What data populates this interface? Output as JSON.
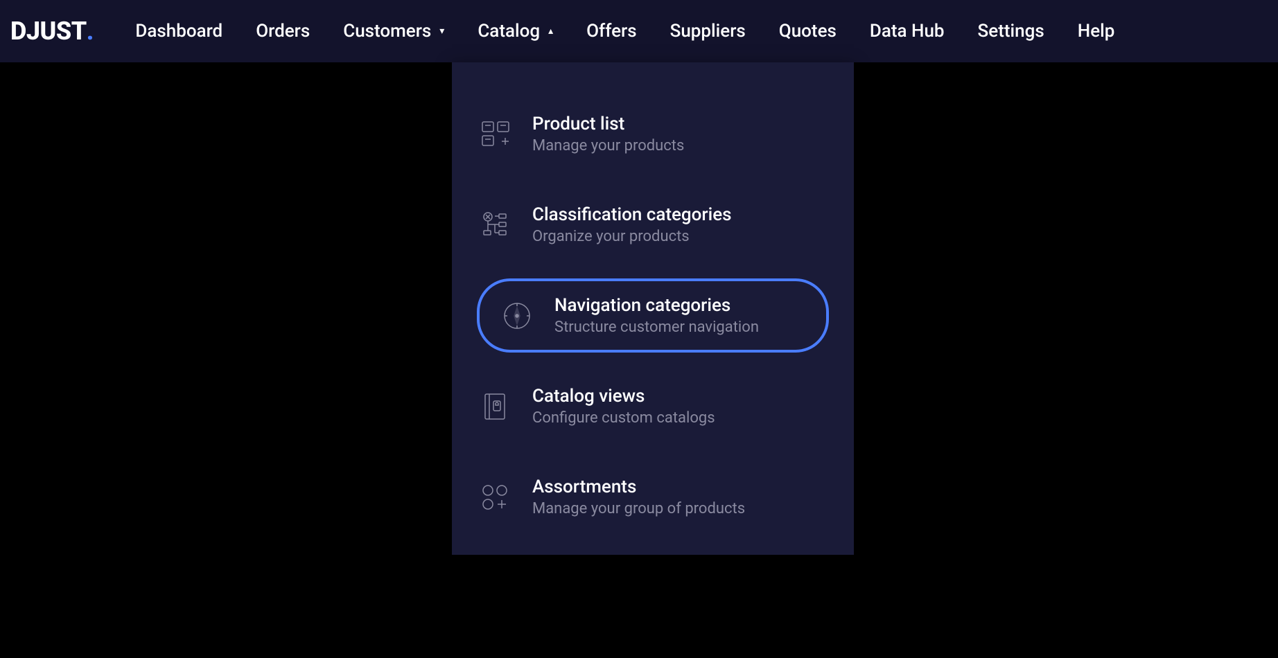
{
  "logo": {
    "text": "DJUST",
    "accent": "."
  },
  "nav": {
    "items": [
      {
        "label": "Dashboard",
        "hasDropdown": false
      },
      {
        "label": "Orders",
        "hasDropdown": false
      },
      {
        "label": "Customers",
        "hasDropdown": true,
        "arrow": "▾"
      },
      {
        "label": "Catalog",
        "hasDropdown": true,
        "arrow": "▴"
      },
      {
        "label": "Offers",
        "hasDropdown": false
      },
      {
        "label": "Suppliers",
        "hasDropdown": false
      },
      {
        "label": "Quotes",
        "hasDropdown": false
      },
      {
        "label": "Data Hub",
        "hasDropdown": false
      },
      {
        "label": "Settings",
        "hasDropdown": false
      },
      {
        "label": "Help",
        "hasDropdown": false
      }
    ]
  },
  "catalogMenu": {
    "items": [
      {
        "title": "Product list",
        "subtitle": "Manage your products",
        "icon": "product-list-icon",
        "highlighted": false
      },
      {
        "title": "Classification categories",
        "subtitle": "Organize your products",
        "icon": "classification-icon",
        "highlighted": false
      },
      {
        "title": "Navigation categories",
        "subtitle": "Structure customer navigation",
        "icon": "compass-icon",
        "highlighted": true
      },
      {
        "title": "Catalog views",
        "subtitle": "Configure custom catalogs",
        "icon": "catalog-views-icon",
        "highlighted": false
      },
      {
        "title": "Assortments",
        "subtitle": "Manage your group of products",
        "icon": "assortments-icon",
        "highlighted": false
      }
    ]
  }
}
